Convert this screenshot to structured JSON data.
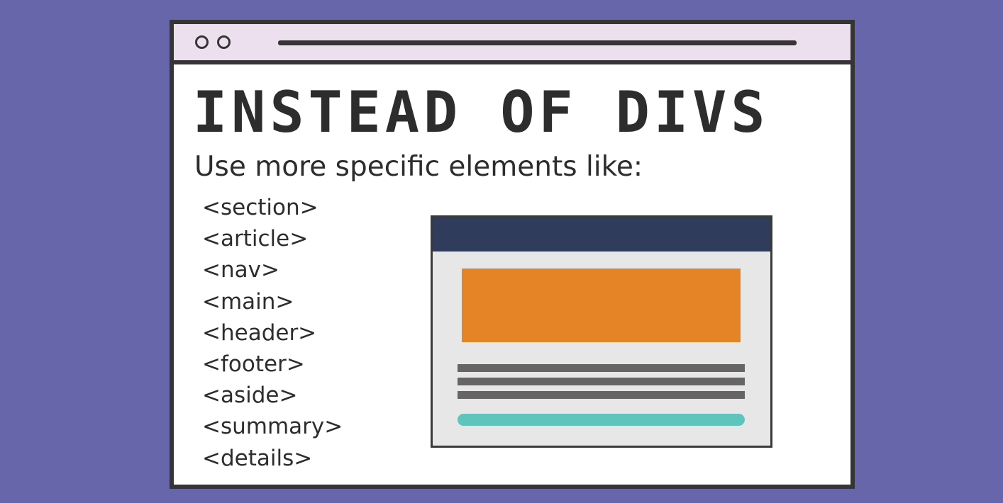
{
  "headline": "INSTEAD OF DIVS",
  "subtitle": "Use more specific elements like:",
  "elements": [
    "<section>",
    "<article>",
    "<nav>",
    "<main>",
    "<header>",
    "<footer>",
    "<aside>",
    "<summary>",
    "<details>"
  ],
  "colors": {
    "background": "#6766ab",
    "window_frame": "#353535",
    "titlebar": "#ede0ee",
    "illustration_header": "#303c5c",
    "illustration_hero": "#e58427",
    "illustration_text_lines": "#666464",
    "illustration_button": "#5fc4bc",
    "illustration_page": "#e7e7e7"
  }
}
